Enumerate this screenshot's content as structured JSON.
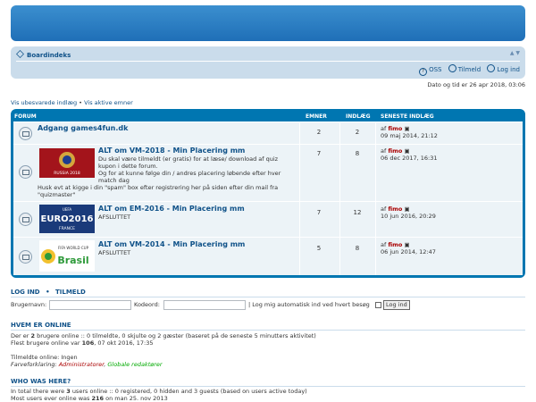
{
  "nav": {
    "breadcrumb": "Boardindeks",
    "font_size": "▲ ▼",
    "links": {
      "faq": "OSS",
      "members": "Tilmeld",
      "login": "Log ind"
    }
  },
  "date_text": "Dato og tid er 26 apr 2018, 03:06",
  "unread": {
    "unanswered": "Vis ubesvarede indlæg",
    "sep": " • ",
    "active": "Vis aktive emner"
  },
  "forum": {
    "headers": {
      "forum": "FORUM",
      "topics": "EMNER",
      "posts": "INDLÆG",
      "last": "SENESTE INDLÆG"
    },
    "rows": [
      {
        "title": "Adgang games4fun.dk",
        "desc": "",
        "topics": "2",
        "posts": "2",
        "last_by_prefix": "af ",
        "last_by": "fimo",
        "last_date": "09 maj 2014, 21:12"
      },
      {
        "title": "ALT om VM-2018 - Min Placering mm",
        "desc_lines": [
          "Du skal være tilmeldt (er gratis) for at læse/ download af quiz",
          "kupon i dette forum.",
          "Og for at kunne følge din / andres placering løbende efter hver",
          "match dag"
        ],
        "desc_extra": "Husk evt at kigge i din \"spam\" box efter registrering her på siden efter din mail fra \"quizmaster\"",
        "topics": "7",
        "posts": "8",
        "last_by_prefix": "af ",
        "last_by": "fimo",
        "last_date": "06 dec 2017, 16:31",
        "logo": "RUSSIA 2018"
      },
      {
        "title": "ALT om EM-2016 - Min Placering mm",
        "desc": "AFSLUTTET",
        "topics": "7",
        "posts": "12",
        "last_by_prefix": "af ",
        "last_by": "fimo",
        "last_date": "10 jun 2016, 20:29",
        "logo_top": "UEFA",
        "logo_main": "EURO2016",
        "logo_sub": "FRANCE"
      },
      {
        "title": "ALT om VM-2014 - Min Placering mm",
        "desc": "AFSLUTTET",
        "topics": "5",
        "posts": "8",
        "last_by_prefix": "af ",
        "last_by": "fimo",
        "last_date": "06 jun 2014, 12:47",
        "logo_top": "FIFA WORLD CUP",
        "logo_main": "Brasil"
      }
    ]
  },
  "login": {
    "heading_login": "LOG IND",
    "heading_sep": "•",
    "heading_register": "TILMELD",
    "username_label": "Brugernavn:",
    "password_label": "Kodeord:",
    "autologin": "| Log mig automatisk ind ved hvert besøg",
    "button": "Log ind"
  },
  "online": {
    "heading": "HVEM ER ONLINE",
    "line1_a": "Der er ",
    "line1_count": "2",
    "line1_b": " brugere online :: 0 tilmeldte, 0 skjulte og 2 gæster (baseret på de seneste 5 minutters aktivitet)",
    "line2_a": "Flest brugere online var ",
    "line2_count": "106",
    "line2_b": ", 07 okt 2016, 17:35",
    "registered": "Tilmeldte online: Ingen",
    "legend_label": "Farveforklaring:",
    "legend_admin": "Administratorer",
    "legend_sep": ", ",
    "legend_mod": "Globale redaktører"
  },
  "who_was": {
    "heading": "WHO WAS HERE?",
    "line1_a": "In total there were ",
    "line1_count": "3",
    "line1_b": " users online :: 0 registered, 0 hidden and 3 guests (based on users active today)",
    "line2_a": "Most users ever online was ",
    "line2_count": "216",
    "line2_b": " on man 25. nov 2013"
  },
  "colors": {
    "header": "#1f6fb7",
    "forum_frame": "#0076b1",
    "row_bg": "#ecf3f7",
    "link": "#105289",
    "admin": "#aa0000",
    "mod": "#00aa00"
  }
}
